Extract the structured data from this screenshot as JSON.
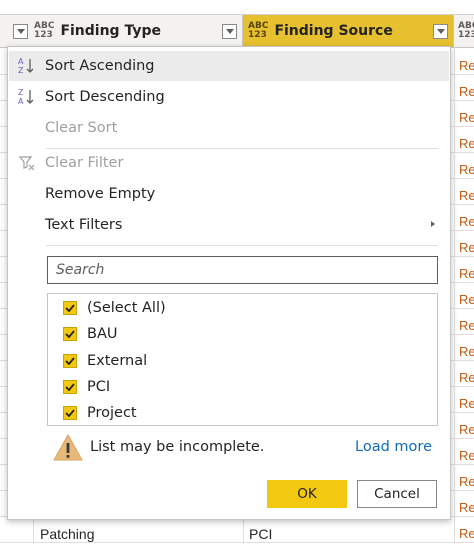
{
  "grid": {
    "columns": [
      {
        "type_badge": [
          "ABC",
          "123"
        ],
        "label": "Finding Type",
        "active": false
      },
      {
        "type_badge": [
          "ABC",
          "123"
        ],
        "label": "Finding Source",
        "active": true
      },
      {
        "type_badge": [
          "ABC",
          "123"
        ],
        "label": "",
        "active": false
      }
    ],
    "truncated_cell_text": "Re",
    "last_row": {
      "finding_type": "Patching",
      "finding_source": "PCI"
    }
  },
  "menu": {
    "sort_ascending": "Sort Ascending",
    "sort_descending": "Sort Descending",
    "clear_sort": "Clear Sort",
    "clear_filter": "Clear Filter",
    "remove_empty": "Remove Empty",
    "text_filters": "Text Filters",
    "search_placeholder": "Search",
    "checklist": [
      {
        "label": "(Select All)",
        "checked": true
      },
      {
        "label": "BAU",
        "checked": true
      },
      {
        "label": "External",
        "checked": true
      },
      {
        "label": "PCI",
        "checked": true
      },
      {
        "label": "Project",
        "checked": true
      }
    ],
    "warning_text": "List may be incomplete.",
    "load_more": "Load more",
    "ok_label": "OK",
    "cancel_label": "Cancel"
  },
  "colors": {
    "accent_yellow": "#f2c811",
    "active_header": "#e6c02e",
    "link_blue": "#0f6cbd",
    "truncated_text": "#c55a11"
  }
}
